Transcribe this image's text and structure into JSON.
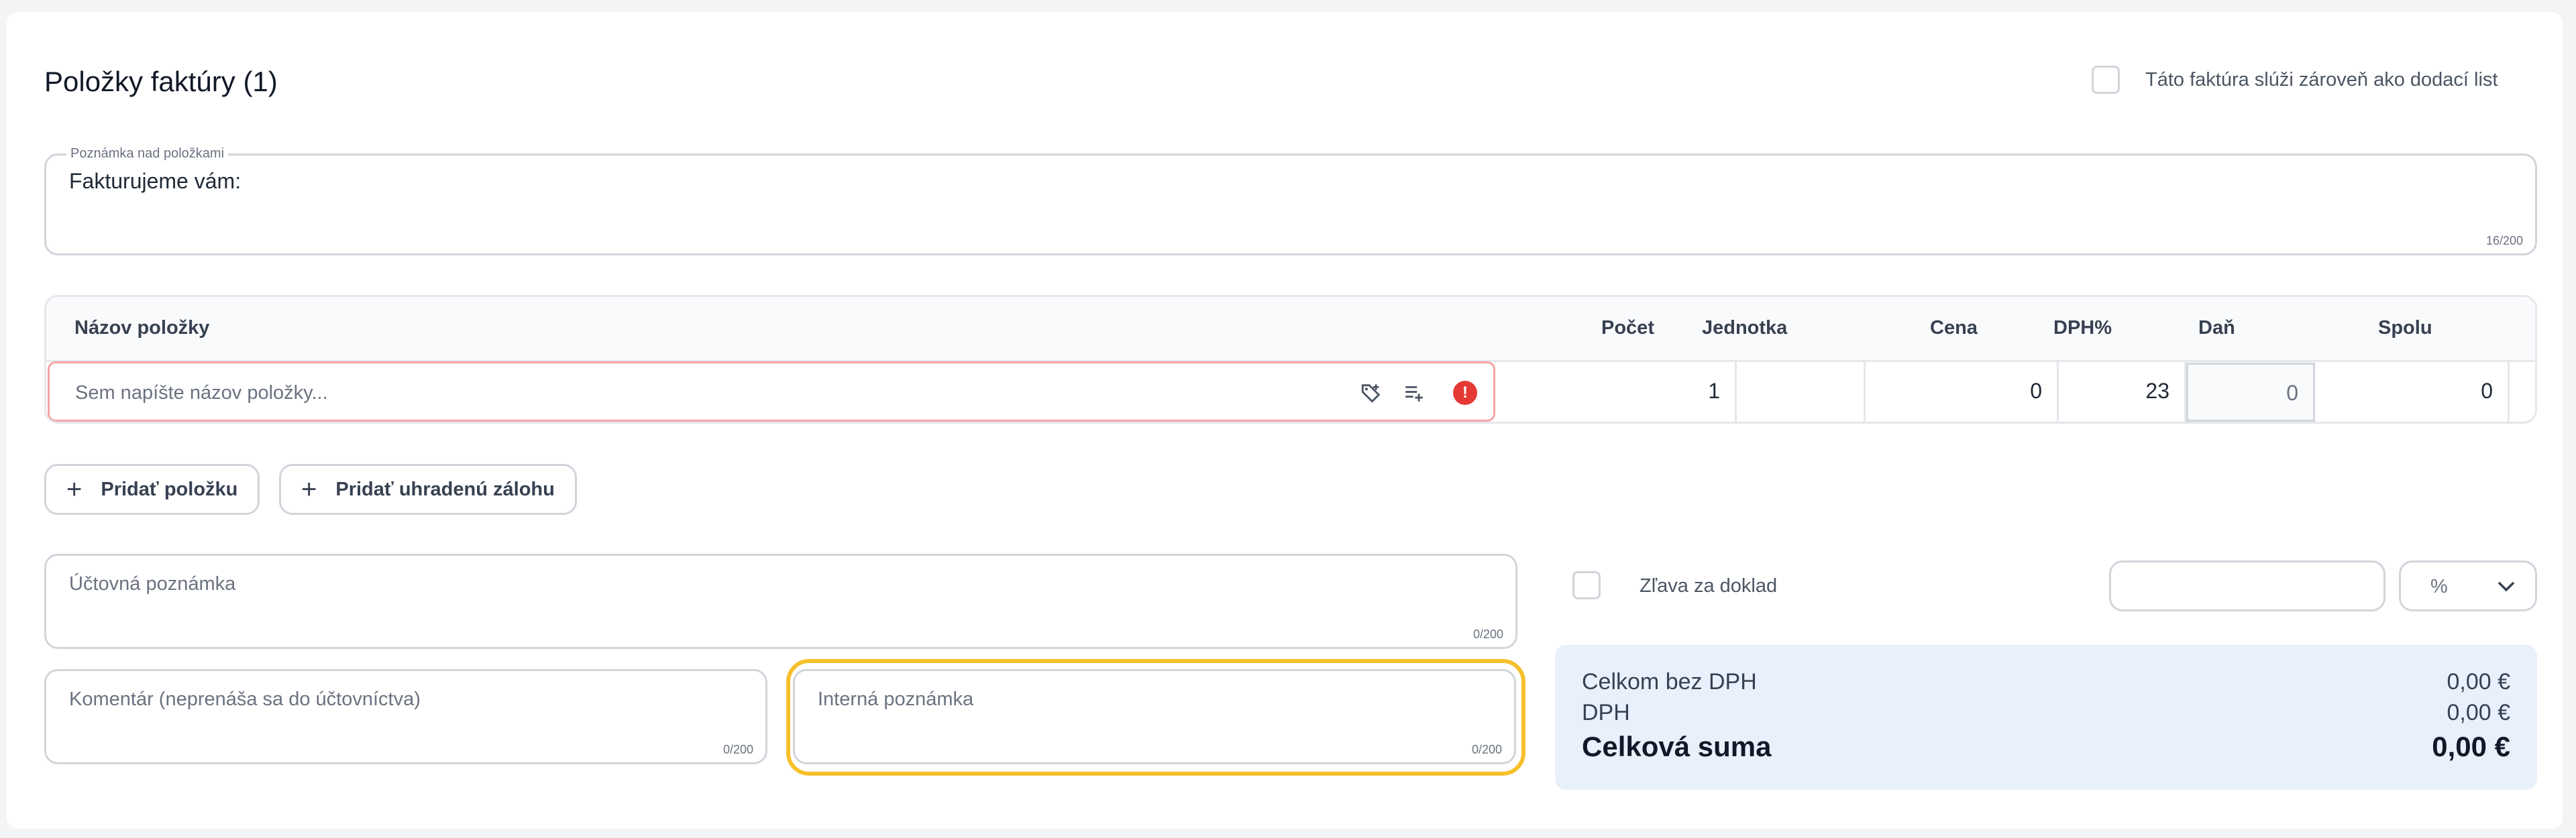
{
  "section": {
    "title": "Položky faktúry (1)"
  },
  "delivery_note": {
    "label": "Táto faktúra slúži zároveň ako dodací list",
    "checked": false
  },
  "note_above": {
    "label": "Poznámka nad položkami",
    "value": "Fakturujeme vám:",
    "counter": "16/200"
  },
  "table": {
    "headers": {
      "name": "Názov položky",
      "count": "Počet",
      "unit": "Jednotka",
      "price": "Cena",
      "vat_pct": "DPH%",
      "tax": "Daň",
      "total": "Spolu"
    },
    "row": {
      "name_placeholder": "Sem napíšte názov položky...",
      "count": "1",
      "unit": "",
      "price": "0",
      "vat_pct": "23",
      "tax": "0",
      "total": "0"
    },
    "icons": [
      "tag-add-icon",
      "list-add-icon",
      "error-icon"
    ]
  },
  "buttons": {
    "add_item": "Pridať položku",
    "add_deposit": "Pridať uhradenú zálohu"
  },
  "accounting_note": {
    "placeholder": "Účtovná poznámka",
    "counter": "0/200"
  },
  "comment": {
    "placeholder": "Komentár (neprenáša sa do účtovníctva)",
    "counter": "0/200"
  },
  "internal_note": {
    "placeholder": "Interná poznámka",
    "counter": "0/200"
  },
  "discount": {
    "label": "Zľava za doklad",
    "checked": false,
    "value": "",
    "unit": "%"
  },
  "summary": {
    "subtotal_label": "Celkom bez DPH",
    "subtotal_value": "0,00 €",
    "vat_label": "DPH",
    "vat_value": "0,00 €",
    "total_label": "Celková suma",
    "total_value": "0,00 €",
    "background": "#e8f1fb"
  },
  "colors": {
    "error": "#e53935",
    "highlight": "#f6c02b",
    "border": "#d1d5db"
  }
}
